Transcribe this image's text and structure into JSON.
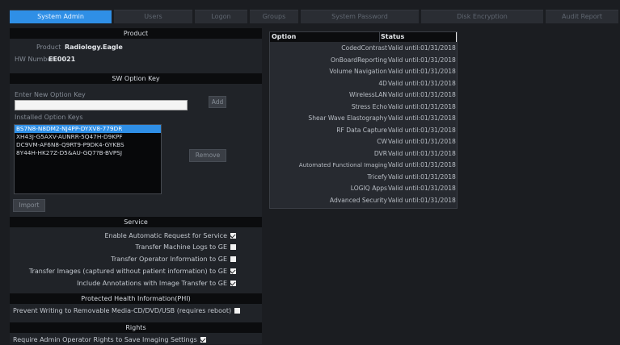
{
  "tabs": [
    {
      "label": "System Admin",
      "active": true
    },
    {
      "label": "Users",
      "active": false
    },
    {
      "label": "Logon",
      "active": false
    },
    {
      "label": "Groups",
      "active": false
    },
    {
      "label": "System Password",
      "active": false
    },
    {
      "label": "Disk Encryption",
      "active": false
    },
    {
      "label": "Audit Report",
      "active": false
    }
  ],
  "product": {
    "header": "Product",
    "product_label": "Product",
    "product_value": "Radiology.Eagle",
    "hw_label": "HW Number",
    "hw_value": "EE0021"
  },
  "sw_option_key": {
    "header": "SW Option Key",
    "enter_label": "Enter New Option Key",
    "input_value": "",
    "add_label": "Add",
    "installed_label": "Installed Option Keys",
    "keys": [
      "BS7N8-N8DM2-NJ4PP-DYXV8-779DR",
      "XH43J-G5AXV-AUNRR-5Q47H-D9KPF",
      "DC9VM-AF6N8-Q9RT9-P9DK4-GYKBS",
      "8Y44H-HK27Z-D5&AU-GQ7?B-BVPSJ"
    ],
    "remove_label": "Remove",
    "import_label": "Import"
  },
  "service": {
    "header": "Service",
    "items": [
      {
        "label": "Enable Automatic Request for Service",
        "checked": true
      },
      {
        "label": "Transfer Machine Logs to GE",
        "checked": false
      },
      {
        "label": "Transfer Operator Information to GE",
        "checked": false
      },
      {
        "label": "Transfer Images (captured without patient information) to GE",
        "checked": true
      },
      {
        "label": "Include Annotations with Image Transfer to GE",
        "checked": true
      }
    ]
  },
  "phi": {
    "header": "Protected Health Information(PHI)",
    "item": {
      "label": "Prevent Writing to Removable Media-CD/DVD/USB (requires reboot)",
      "checked": false
    }
  },
  "rights": {
    "header": "Rights",
    "item": {
      "label": "Require Admin Operator Rights to Save Imaging Settings",
      "checked": true
    }
  },
  "options_table": {
    "col_option": "Option",
    "col_status": "Status",
    "rows": [
      {
        "option": "CodedContrast",
        "status": "Valid until:01/31/2018"
      },
      {
        "option": "OnBoardReporting",
        "status": "Valid until:01/31/2018"
      },
      {
        "option": "Volume Navigation",
        "status": "Valid until:01/31/2018"
      },
      {
        "option": "4D",
        "status": "Valid until:01/31/2018"
      },
      {
        "option": "WirelessLAN",
        "status": "Valid until:01/31/2018"
      },
      {
        "option": "Stress Echo",
        "status": "Valid until:01/31/2018"
      },
      {
        "option": "Shear Wave Elastography",
        "status": "Valid until:01/31/2018"
      },
      {
        "option": "RF Data Capture",
        "status": "Valid until:01/31/2018"
      },
      {
        "option": "CW",
        "status": "Valid until:01/31/2018"
      },
      {
        "option": "DVR",
        "status": "Valid until:01/31/2018"
      },
      {
        "option": "Automated Functional Imaging",
        "status": "Valid until:01/31/2018"
      },
      {
        "option": "Tricefy",
        "status": "Valid until:01/31/2018"
      },
      {
        "option": "LOGIQ Apps",
        "status": "Valid until:01/31/2018"
      },
      {
        "option": "Advanced Security",
        "status": "Valid until:01/31/2018"
      }
    ]
  },
  "colors": {
    "accent": "#2f8fe6",
    "background": "#1b1d21",
    "header_bar": "#0b0c0e"
  }
}
